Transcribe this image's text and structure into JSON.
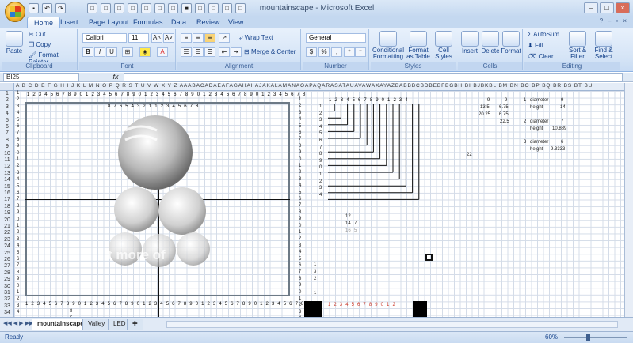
{
  "window": {
    "title": "mountainscape - Microsoft Excel"
  },
  "tabs": [
    "Home",
    "Insert",
    "Page Layout",
    "Formulas",
    "Data",
    "Review",
    "View"
  ],
  "ribbon": {
    "clipboard": {
      "paste": "Paste",
      "cut": "Cut",
      "copy": "Copy",
      "format_painter": "Format Painter",
      "label": "Clipboard"
    },
    "font": {
      "name": "Calibri",
      "size": "11",
      "bold": "B",
      "italic": "I",
      "underline": "U",
      "grow": "A˄",
      "shrink": "A˅",
      "label": "Font"
    },
    "alignment": {
      "wrap": "Wrap Text",
      "merge": "Merge & Center",
      "label": "Alignment"
    },
    "number": {
      "format": "General",
      "currency": "$",
      "percent": "%",
      "comma": ",",
      "label": "Number"
    },
    "styles": {
      "conditional": "Conditional Formatting",
      "table": "Format as Table",
      "cell": "Cell Styles",
      "label": "Styles"
    },
    "cells": {
      "insert": "Insert",
      "delete": "Delete",
      "format": "Format",
      "label": "Cells"
    },
    "editing": {
      "autosum": "AutoSum",
      "fill": "Fill",
      "clear": "Clear",
      "sort": "Sort & Filter",
      "find": "Find & Select",
      "label": "Editing"
    }
  },
  "formula_bar": {
    "name_box": "BI25",
    "fx": "fx",
    "value": ""
  },
  "columns": "A B C D E F G H I J K L M N O P Q R S T U V W X Y Z AAABACADAEAFAGAHAI AJAKALAMANAOAPAQARASATAUAVAWAXAYAZBABBBCBDBEBFBGBH BI BJBKBL BM BN BO BP BQ BR BS BT BU",
  "column_tail": [
    "BM",
    "BN",
    "BO",
    "BP",
    "BQ",
    "BR",
    "BS",
    "BT",
    "BU"
  ],
  "rows": [
    "1",
    "2",
    "3",
    "4",
    "5",
    "6",
    "7",
    "8",
    "9",
    "10",
    "11",
    "12",
    "13",
    "14",
    "15",
    "16",
    "17",
    "18",
    "19",
    "20",
    "21",
    "22",
    "23",
    "24",
    "25",
    "26",
    "27",
    "28",
    "29",
    "30",
    "31",
    "32",
    "33",
    "34"
  ],
  "top_ruler": "1 2 3 4 5 6 7 8 9 0 1 2 3 4 5 6 7 8 9 0 1 2 3 4 5 6 7 8 9 0 1 2 3 4 5 6 7 8 9 0 1 2 3 4 5 6 7 8",
  "bottom_ruler": "1 2 3 4 5 6 7 8 9 0 1 2 3 4 5 6 7 8 9 0 1 2 3 4 5 6 7 8 9 0 1 2 3 4 5 6 7 8 9 0 1 2 3 4 5 6 7 8",
  "inner_ruler": "8 7 6 5 4 3 2 1 1 2 3 4 5 6 7 8",
  "stair_header": "1 2 3 4 5 6 7 8 9 0 1 2 3 4",
  "stair_rows": [
    "1",
    "2",
    "3",
    "4",
    "5",
    "6",
    "7",
    "8",
    "9",
    "0",
    "1",
    "2",
    "3",
    "4"
  ],
  "left_rows": [
    "1",
    "2",
    "3",
    "4",
    "5",
    "6",
    "7",
    "8",
    "9",
    "0",
    "1",
    "2",
    "3",
    "4",
    "5",
    "6",
    "7",
    "8",
    "9",
    "0",
    "1",
    "2",
    "3",
    "4",
    "5",
    "6",
    "7",
    "8",
    "9",
    "0",
    "1",
    "2",
    "3",
    "4"
  ],
  "mid_values": {
    "a": "12",
    "b": "14",
    "c": "7",
    "d": "16",
    "e": "5",
    "f": "22"
  },
  "calc": {
    "bn_vals": [
      "13.5",
      "20.25"
    ],
    "bo_vals": [
      "9",
      "6.75",
      "6.75",
      "22.5"
    ],
    "bn_top": "9",
    "r1": {
      "num": "1",
      "label_a": "diameter",
      "val_a": "9",
      "label_b": "height",
      "val_b": "14"
    },
    "r2": {
      "num": "2",
      "label_a": "diameter",
      "val_a": "7",
      "label_b": "height",
      "val_b": "10.889"
    },
    "r3": {
      "num": "3",
      "label_a": "diameter",
      "val_a": "6",
      "label_b": "height",
      "val_b": "9.3333"
    }
  },
  "low_values": [
    "1",
    "3",
    "2",
    "1"
  ],
  "bottom_strip": "1 2 3 4 5 6 7 8 9 0 1 2",
  "row_bottom": [
    "8",
    "5"
  ],
  "sheets": [
    "mountainscape",
    "Valley",
    "LED"
  ],
  "status": {
    "ready": "Ready",
    "zoom": "60%"
  },
  "watermark": "t more of"
}
